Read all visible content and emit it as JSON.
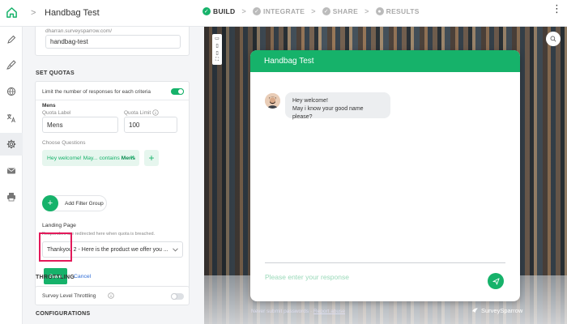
{
  "app": {
    "title": "Handbag Test",
    "breadcrumb_sep": ">",
    "steps": [
      {
        "label": "BUILD",
        "active": true,
        "mark": "✓"
      },
      {
        "label": "INTEGRATE",
        "active": false,
        "mark": "✓"
      },
      {
        "label": "SHARE",
        "active": false,
        "mark": "✓"
      },
      {
        "label": "RESULTS",
        "active": false,
        "mark": "●"
      }
    ],
    "step_sep": ">",
    "more_menu": "⋮"
  },
  "rail": {
    "items": [
      "pen-icon",
      "brush-icon",
      "globe-icon",
      "translate-icon",
      "gear-icon",
      "mail-icon",
      "print-icon"
    ],
    "active": "gear-icon"
  },
  "url_card": {
    "url_prefix": "dharran.surveysparrow.com/",
    "slug": "handbag-test"
  },
  "quotas": {
    "heading": "SET QUOTAS",
    "limit_label": "Limit the number of responses for each criteria",
    "limit_enabled": true,
    "group_title": "Mens",
    "quota_label_caption": "Quota Label",
    "quota_limit_caption": "Quota Limit",
    "quota_label_value": "Mens",
    "quota_limit_value": "100",
    "choose_questions": "Choose Questions",
    "filter_chip_prefix": "Hey welcome! May... contains ",
    "filter_chip_value": "Mens",
    "chip_remove": "×",
    "add_filter_plus": "+",
    "add_filter_group_plus": "+",
    "add_filter_group": "Add Filter Group",
    "landing_page_title": "Landing Page",
    "landing_page_hint": "Responders are redirected here when quota is breached.",
    "landing_page_value": "Thankyou 2 - Here is the product we offer you ...",
    "save_label": "Save",
    "cancel_label": "Cancel"
  },
  "throttling": {
    "heading": "THROTTLING",
    "survey_level": "Survey Level Throttling",
    "enabled": false
  },
  "configurations": {
    "heading": "CONFIGURATIONS"
  },
  "preview": {
    "chat_title": "Handbag Test",
    "message_line1": "Hey welcome!",
    "message_line2": "May i know your good name please?",
    "response_placeholder": "Please enter your response",
    "footer_left": "Never submit passwords",
    "footer_dot": "·",
    "footer_report": "Report abuse",
    "brand": "SurveySparrow"
  },
  "colors": {
    "accent": "#16b26a",
    "highlight": "#e3195a"
  }
}
